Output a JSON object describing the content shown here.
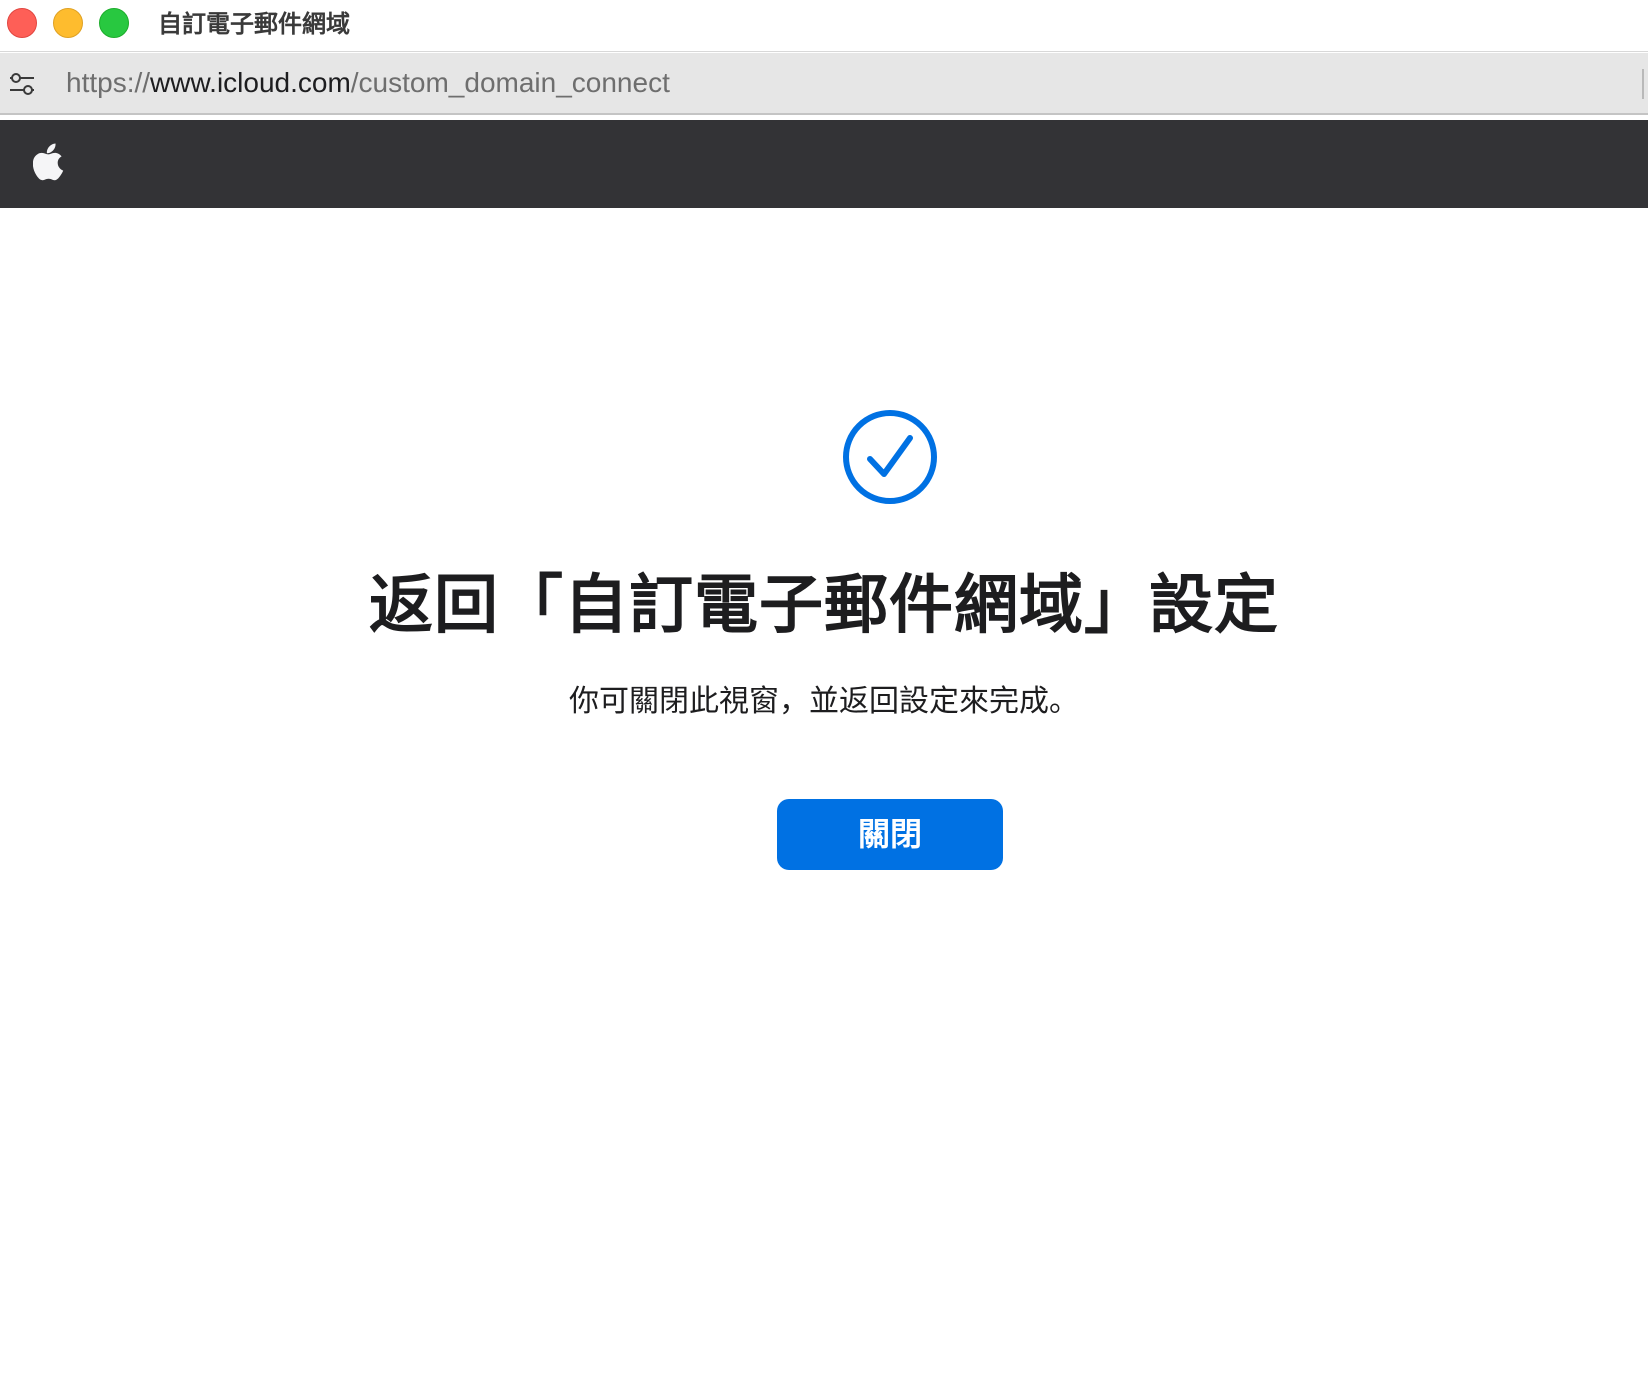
{
  "window": {
    "title": "自訂電子郵件網域"
  },
  "address_bar": {
    "url_prefix": "https://",
    "url_host": "www.icloud.com",
    "url_path": "/custom_domain_connect",
    "site_settings_icon": "sliders-icon"
  },
  "nav": {
    "logo_icon": "apple-logo-icon"
  },
  "main": {
    "status_icon": "checkmark-circle-icon",
    "headline": "返回「自訂電子郵件網域」設定",
    "subtext": "你可關閉此視窗，並返回設定來完成。",
    "close_button_label": "關閉"
  },
  "colors": {
    "accent": "#0071e3",
    "nav_bg": "#333336",
    "text": "#1d1d1f"
  }
}
